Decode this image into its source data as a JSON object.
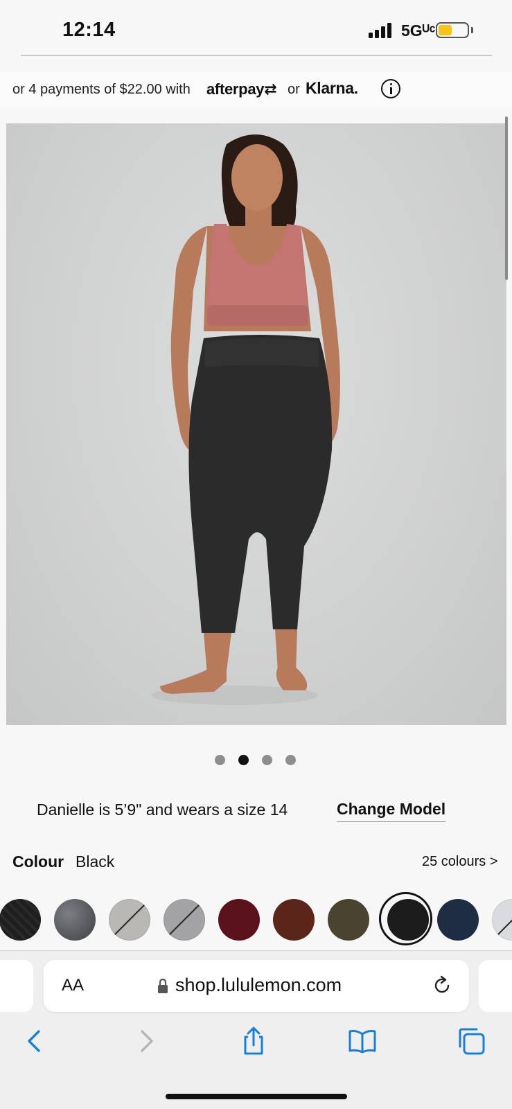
{
  "status_bar": {
    "time": "12:14",
    "network": "5Gᵁᶜ",
    "battery_level": 0.45
  },
  "payments": {
    "text": "or 4 payments of $22.00 with",
    "afterpay": "afterpay⇄",
    "or": "or",
    "klarna": "Klarna."
  },
  "carousel": {
    "total": 4,
    "active": 2
  },
  "model_info": {
    "text": "Danielle is 5’9\" and wears a size 14",
    "change_label": "Change Model"
  },
  "colour": {
    "label": "Colour",
    "value": "Black",
    "count": "25 colours >"
  },
  "swatches": [
    {
      "color": "#1e1e1e",
      "pattern": "textured"
    },
    {
      "color": "#5a5c60",
      "pattern": "marble"
    },
    {
      "color": "#b9b8b4",
      "pattern": "slashed"
    },
    {
      "color": "#a3a3a5",
      "pattern": "slashed"
    },
    {
      "color": "#5a1119",
      "pattern": "solid"
    },
    {
      "color": "#5a2619",
      "pattern": "solid"
    },
    {
      "color": "#4a4330",
      "pattern": "solid"
    },
    {
      "color": "#1c1c1c",
      "pattern": "selected"
    },
    {
      "color": "#1e2d44",
      "pattern": "solid"
    },
    {
      "color": "#d9dbde",
      "pattern": "slashed"
    }
  ],
  "browser": {
    "aa_label": "AA",
    "url": "shop.lululemon.com"
  },
  "colors": {
    "accent_blue": "#1a7fd4",
    "disabled_gray": "#b5b5b5"
  },
  "icons": [
    "info-icon",
    "lock-icon",
    "reload-icon",
    "back-icon",
    "forward-icon",
    "share-icon",
    "bookmarks-icon",
    "tabs-icon"
  ]
}
